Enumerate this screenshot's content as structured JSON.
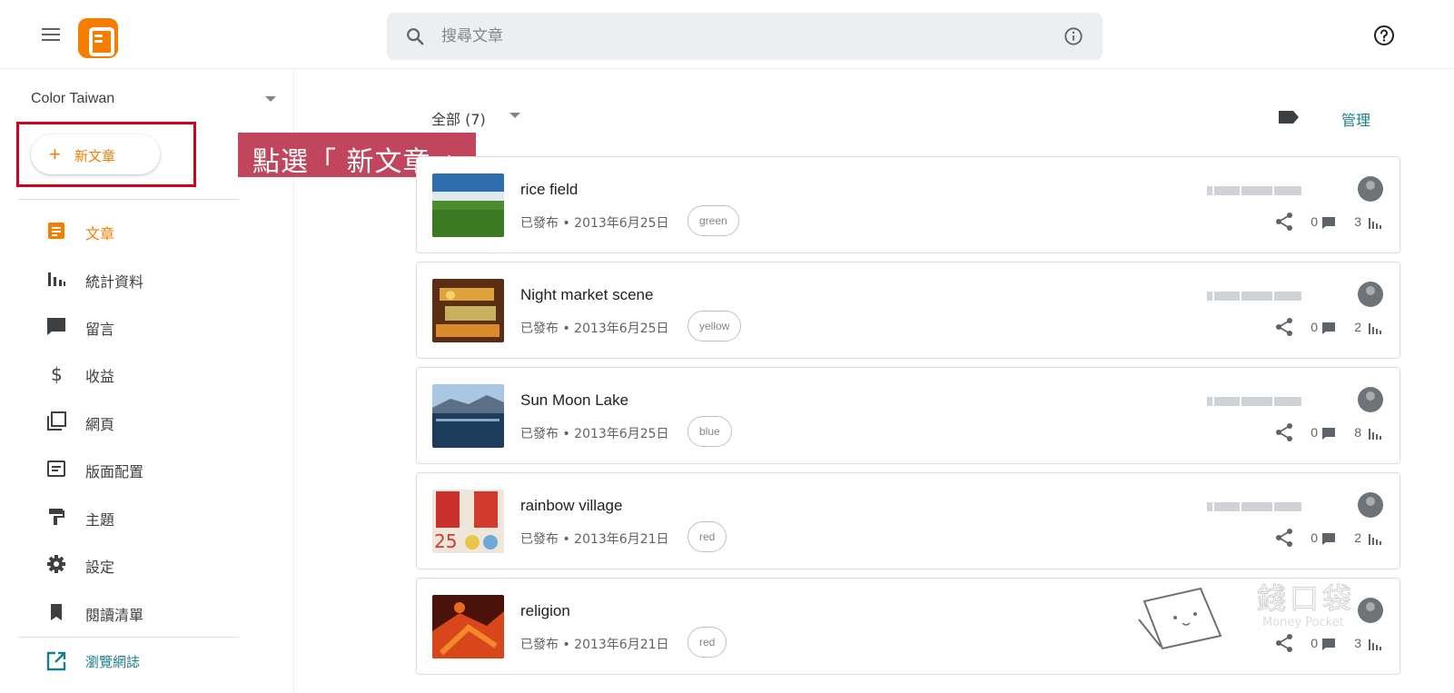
{
  "header": {
    "search_placeholder": "搜尋文章",
    "icons": [
      "menu-icon",
      "blogger-logo",
      "search-icon",
      "info-icon",
      "help-icon"
    ]
  },
  "sidebar": {
    "blog_name": "Color Taiwan",
    "new_post_label": "新文章",
    "items": [
      {
        "label": "文章",
        "icon": "posts-icon"
      },
      {
        "label": "統計資料",
        "icon": "stats-icon"
      },
      {
        "label": "留言",
        "icon": "comments-icon"
      },
      {
        "label": "收益",
        "icon": "earnings-icon"
      },
      {
        "label": "網頁",
        "icon": "pages-icon"
      },
      {
        "label": "版面配置",
        "icon": "layout-icon"
      },
      {
        "label": "主題",
        "icon": "theme-icon"
      },
      {
        "label": "設定",
        "icon": "settings-icon"
      },
      {
        "label": "閱讀清單",
        "icon": "reading-list-icon"
      }
    ],
    "view_blog_label": "瀏覽網誌"
  },
  "callout": {
    "text": "點選「 新文章 」"
  },
  "main": {
    "filter_label": "全部 (7)",
    "manage_label": "管理",
    "posts": [
      {
        "title": "rice field",
        "meta": "已發布 • 2013年6月25日",
        "tag": "green",
        "comments": "0",
        "views": "3"
      },
      {
        "title": "Night market scene",
        "meta": "已發布 • 2013年6月25日",
        "tag": "yellow",
        "comments": "0",
        "views": "2"
      },
      {
        "title": "Sun Moon Lake",
        "meta": "已發布 • 2013年6月25日",
        "tag": "blue",
        "comments": "0",
        "views": "8"
      },
      {
        "title": "rainbow village",
        "meta": "已發布 • 2013年6月21日",
        "tag": "red",
        "comments": "0",
        "views": "2"
      },
      {
        "title": "religion",
        "meta": "已發布 • 2013年6月21日",
        "tag": "red",
        "comments": "0",
        "views": "3"
      }
    ]
  },
  "watermark": {
    "title": "錢口袋",
    "subtitle": "Money Pocket"
  },
  "colors": {
    "accent": "#f57d00",
    "link": "#1a7f86",
    "callout": "#c0455d",
    "highlight": "#d0021b"
  }
}
